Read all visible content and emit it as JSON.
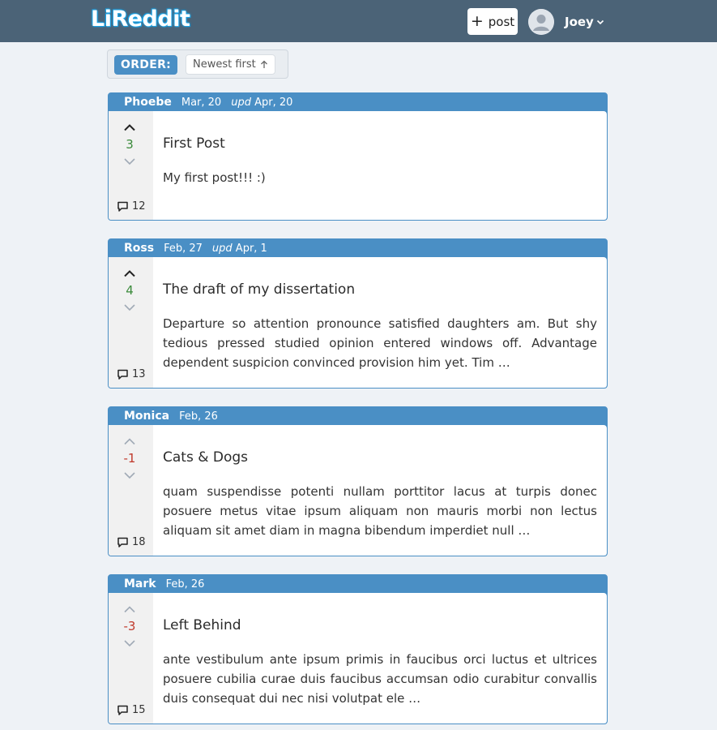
{
  "navbar": {
    "logo": "LiReddit",
    "post_button_label": "post",
    "username": "Joey"
  },
  "order": {
    "label": "ORDER:",
    "selected": "Newest first"
  },
  "posts": [
    {
      "author": "Phoebe",
      "date": "Mar, 20",
      "upd_label": "upd",
      "updated": "Apr, 20",
      "score": "3",
      "vote": "up",
      "comments": "12",
      "title": "First Post",
      "snippet": "My first post!!! :)"
    },
    {
      "author": "Ross",
      "date": "Feb, 27",
      "upd_label": "upd",
      "updated": "Apr, 1",
      "score": "4",
      "vote": "up",
      "comments": "13",
      "title": "The draft of my dissertation",
      "snippet": "Departure so attention pronounce satisfied daughters am. But shy tedious pressed studied opinion entered windows off. Advantage dependent suspicion convinced provision him yet. Tim …"
    },
    {
      "author": "Monica",
      "date": "Feb, 26",
      "score": "-1",
      "vote": "none",
      "comments": "18",
      "title": "Cats & Dogs",
      "snippet": "quam suspendisse potenti nullam porttitor lacus at turpis donec posuere metus vitae ipsum aliquam non mauris morbi non lectus aliquam sit amet diam in magna bibendum imperdiet null …"
    },
    {
      "author": "Mark",
      "date": "Feb, 26",
      "score": "-3",
      "vote": "none",
      "comments": "15",
      "title": "Left Behind",
      "snippet": "ante vestibulum ante ipsum primis in faucibus orci luctus et ultrices posuere cubilia curae duis faucibus accumsan odio curabitur convallis duis consequat dui nec nisi volutpat ele …"
    }
  ],
  "colors": {
    "navbar": "#4b6377",
    "accent": "#4a8fc5",
    "positive_score": "#3a8a3a",
    "negative_score": "#c0392b",
    "page_bg": "#eef2f6"
  }
}
